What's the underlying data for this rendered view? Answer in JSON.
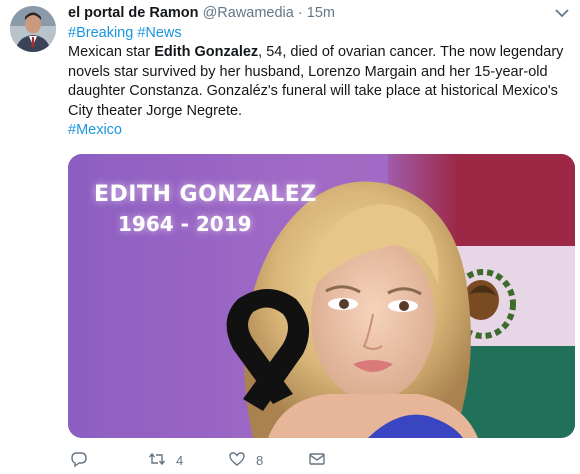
{
  "tweet": {
    "author_name": "el portal de Ramon",
    "handle": "@Rawamedia",
    "separator": "·",
    "time": "15m",
    "hashtags_line": [
      "#Breaking",
      "#News"
    ],
    "body_part1": "Mexican star ",
    "body_bold": "Edith Gonzalez",
    "body_part2": ", 54, died of ovarian cancer. The now legendary novels star survived by her husband, Lorenzo Margain and her 15-year-old daughter Constanza. Gonzaléz's funeral will take place at historical Mexico's City theater Jorge Negrete.",
    "hashtag_footer": "#Mexico"
  },
  "media": {
    "overlay_title": "EDITH GONZALEZ",
    "overlay_years": "1964 - 2019"
  },
  "actions": {
    "reply_count": "",
    "retweet_count": "4",
    "like_count": "8"
  },
  "colors": {
    "link": "#1b95e0",
    "muted": "#657786",
    "flag_red": "#a3203a",
    "flag_white": "#e9dbe8",
    "flag_green": "#1f6a55"
  },
  "icons": [
    "avatar",
    "chevron-down-icon",
    "reply-icon",
    "retweet-icon",
    "like-icon",
    "message-icon",
    "mourning-ribbon-icon",
    "coat-of-arms-icon"
  ]
}
